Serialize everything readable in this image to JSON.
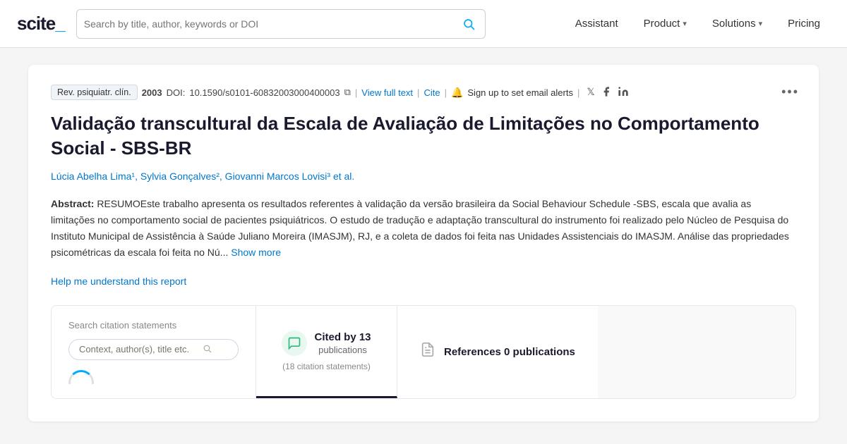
{
  "navbar": {
    "logo_text": "scite_",
    "logo_accent": "_",
    "search_placeholder": "Search by title, author, keywords or DOI",
    "nav_items": [
      {
        "id": "assistant",
        "label": "Assistant",
        "has_chevron": false
      },
      {
        "id": "product",
        "label": "Product",
        "has_chevron": true
      },
      {
        "id": "solutions",
        "label": "Solutions",
        "has_chevron": true
      },
      {
        "id": "pricing",
        "label": "Pricing",
        "has_chevron": false
      }
    ]
  },
  "paper": {
    "journal": "Rev. psiquiatr. clín.",
    "year": "2003",
    "doi_label": "DOI:",
    "doi_value": "10.1590/s0101-60832003000400003",
    "view_full_text": "View full text",
    "cite_label": "Cite",
    "alert_text": "Sign up to set email alerts",
    "more_icon": "•••",
    "title": "Validação transcultural da Escala de Avaliação de Limitações no Comportamento Social - SBS-BR",
    "authors": "Lúcia Abelha Lima¹, Sylvia Gonçalves², Giovanni Marcos Lovisi³ et al.",
    "abstract_label": "Abstract:",
    "abstract_text": "RESUMOEste trabalho apresenta os resultados referentes à validação da versão brasileira da Social Behaviour Schedule -SBS, escala que avalia as limitações no comportamento social de pacientes psiquiátricos. O estudo de tradução e adaptação transcultural do instrumento foi realizado pelo Núcleo de Pesquisa do Instituto Municipal de Assistência à Saúde Juliano Moreira (IMASJM), RJ, e a coleta de dados foi feita nas Unidades Assistenciais do IMASJM. Análise das propriedades psicométricas da escala foi feita no Nú...",
    "show_more_label": "Show more",
    "help_link": "Help me understand this report"
  },
  "bottom": {
    "citation_search_label": "Search citation statements",
    "citation_search_placeholder": "Context, author(s), title etc.",
    "tab_cited_main": "Cited by 13",
    "tab_cited_sub": "publications",
    "tab_citation_sub": "(18 citation",
    "tab_citation_sub2": "statements)",
    "tab_refs_label": "References 0 publications"
  },
  "colors": {
    "accent": "#00aaff",
    "link": "#0077cc",
    "title": "#1a1a2e",
    "tab_bubble_bg": "#e8f7f0"
  }
}
